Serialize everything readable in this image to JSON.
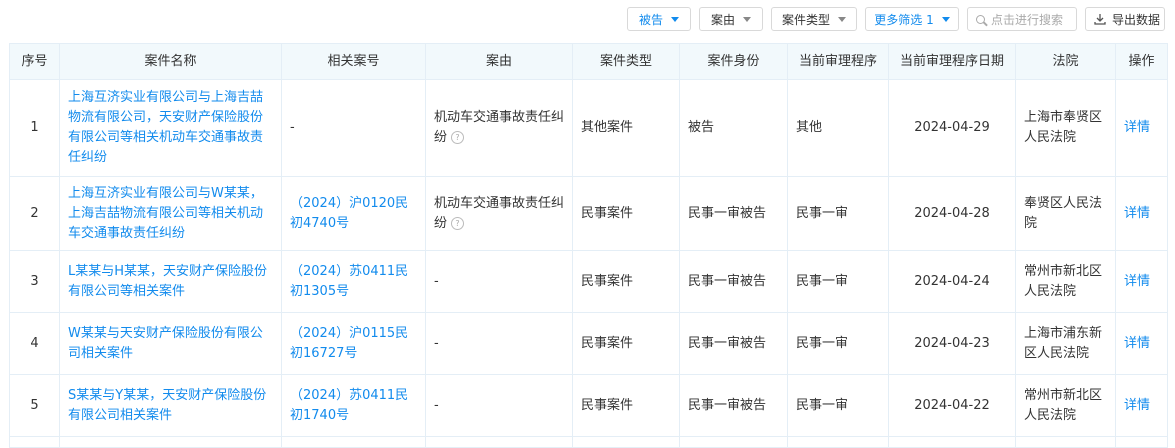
{
  "toolbar": {
    "role_filter": "被告",
    "cause_filter": "案由",
    "type_filter": "案件类型",
    "more_filter": "更多筛选 1",
    "search_placeholder": "点击进行搜索",
    "export": "导出数据"
  },
  "table": {
    "headers": [
      "序号",
      "案件名称",
      "相关案号",
      "案由",
      "案件类型",
      "案件身份",
      "当前审理程序",
      "当前审理程序日期",
      "法院",
      "操作"
    ],
    "rows": [
      {
        "no": "1",
        "name": "上海互济实业有限公司与上海吉喆物流有限公司，天安财产保险股份有限公司等相关机动车交通事故责任纠纷",
        "case_no": "-",
        "cause": "机动车交通事故责任纠纷",
        "type": "其他案件",
        "role": "被告",
        "stage": "其他",
        "date": "2024-04-29",
        "court": "上海市奉贤区人民法院",
        "action": "详情"
      },
      {
        "no": "2",
        "name": "上海互济实业有限公司与W某某，上海吉喆物流有限公司等相关机动车交通事故责任纠纷",
        "case_no": "（2024）沪0120民初4740号",
        "cause": "机动车交通事故责任纠纷",
        "type": "民事案件",
        "role": "民事一审被告",
        "stage": "民事一审",
        "date": "2024-04-28",
        "court": "奉贤区人民法院",
        "action": "详情"
      },
      {
        "no": "3",
        "name": "L某某与H某某，天安财产保险股份有限公司等相关案件",
        "case_no": "（2024）苏0411民初1305号",
        "cause": "-",
        "type": "民事案件",
        "role": "民事一审被告",
        "stage": "民事一审",
        "date": "2024-04-24",
        "court": "常州市新北区人民法院",
        "action": "详情"
      },
      {
        "no": "4",
        "name": "W某某与天安财产保险股份有限公司相关案件",
        "case_no": "（2024）沪0115民初16727号",
        "cause": "-",
        "type": "民事案件",
        "role": "民事一审被告",
        "stage": "民事一审",
        "date": "2024-04-23",
        "court": "上海市浦东新区人民法院",
        "action": "详情"
      },
      {
        "no": "5",
        "name": "S某某与Y某某，天安财产保险股份有限公司相关案件",
        "case_no": "（2024）苏0411民初1740号",
        "cause": "-",
        "type": "民事案件",
        "role": "民事一审被告",
        "stage": "民事一审",
        "date": "2024-04-22",
        "court": "常州市新北区人民法院",
        "action": "详情"
      }
    ]
  }
}
